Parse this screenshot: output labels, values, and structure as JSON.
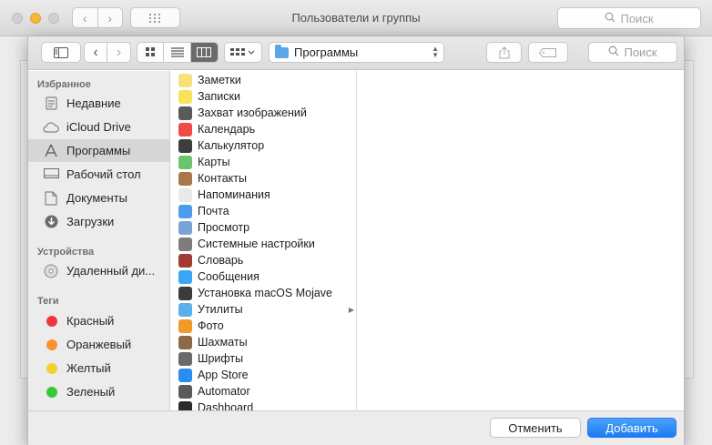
{
  "background_window": {
    "title": "Пользователи и группы",
    "search_placeholder": "Поиск"
  },
  "toolbar": {
    "location": "Программы",
    "search_placeholder": "Поиск"
  },
  "sidebar": {
    "favorites_header": "Избранное",
    "favorites": [
      {
        "label": "Недавние",
        "icon": "recents-icon"
      },
      {
        "label": "iCloud Drive",
        "icon": "cloud-icon"
      },
      {
        "label": "Программы",
        "icon": "applications-icon",
        "selected": true
      },
      {
        "label": "Рабочий стол",
        "icon": "desktop-icon"
      },
      {
        "label": "Документы",
        "icon": "documents-icon"
      },
      {
        "label": "Загрузки",
        "icon": "downloads-icon"
      }
    ],
    "devices_header": "Устройства",
    "devices": [
      {
        "label": "Удаленный ди...",
        "icon": "disc-icon"
      }
    ],
    "tags_header": "Теги",
    "tags": [
      {
        "label": "Красный",
        "color": "#f2373a"
      },
      {
        "label": "Оранжевый",
        "color": "#f8922c"
      },
      {
        "label": "Желтый",
        "color": "#f6cf2d"
      },
      {
        "label": "Зеленый",
        "color": "#35c935"
      }
    ]
  },
  "apps": [
    {
      "label": "Заметки",
      "color": "#f7e178"
    },
    {
      "label": "Записки",
      "color": "#f5e35a"
    },
    {
      "label": "Захват изображений",
      "color": "#5a5a5a"
    },
    {
      "label": "Календарь",
      "color": "#f04b45"
    },
    {
      "label": "Калькулятор",
      "color": "#3d3d3d"
    },
    {
      "label": "Карты",
      "color": "#6cc46a"
    },
    {
      "label": "Контакты",
      "color": "#a7794a"
    },
    {
      "label": "Напоминания",
      "color": "#e9e9e9"
    },
    {
      "label": "Почта",
      "color": "#4b9cf0"
    },
    {
      "label": "Просмотр",
      "color": "#7aa4d8"
    },
    {
      "label": "Системные настройки",
      "color": "#7d7d7d"
    },
    {
      "label": "Словарь",
      "color": "#a33b35"
    },
    {
      "label": "Сообщения",
      "color": "#3aa7f4"
    },
    {
      "label": "Установка macOS Mojave",
      "color": "#3b3b3b"
    },
    {
      "label": "Утилиты",
      "color": "#5ab0ea",
      "folder": true
    },
    {
      "label": "Фото",
      "color": "#f09a2a"
    },
    {
      "label": "Шахматы",
      "color": "#8b6a48"
    },
    {
      "label": "Шрифты",
      "color": "#6a6a6a"
    },
    {
      "label": "App Store",
      "color": "#2a8cf0"
    },
    {
      "label": "Automator",
      "color": "#5a5a5a"
    },
    {
      "label": "Dashboard",
      "color": "#2b2b2b"
    }
  ],
  "footer": {
    "cancel_label": "Отменить",
    "add_label": "Добавить"
  }
}
